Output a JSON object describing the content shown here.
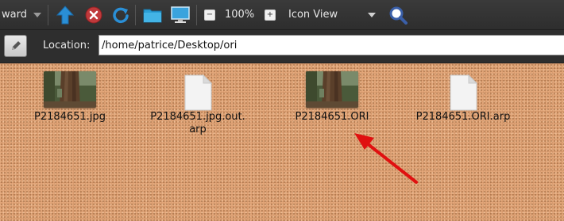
{
  "toolbar": {
    "forward_label": "ward",
    "zoom": "100%",
    "view_mode": "Icon View"
  },
  "location": {
    "label": "Location:",
    "value": "/home/patrice/Desktop/ori"
  },
  "files": [
    {
      "name": "P2184651.jpg",
      "type": "image"
    },
    {
      "name": "P2184651.jpg.out.\narp",
      "type": "document"
    },
    {
      "name": "P2184651.ORI",
      "type": "image"
    },
    {
      "name": "P2184651.ORI.arp",
      "type": "document"
    }
  ],
  "colors": {
    "background_texture": "#e3a77a",
    "arrow": "#e01010",
    "accent_blue": "#2a8fd6"
  }
}
